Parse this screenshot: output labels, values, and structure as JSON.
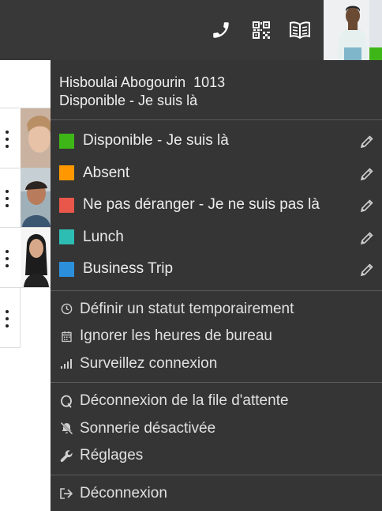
{
  "topbar": {
    "icons": [
      "phone-icon",
      "qr-code-icon",
      "book-icon"
    ],
    "presence_color": "#3fb618"
  },
  "user": {
    "name": "Hisboulai Abogourin",
    "extension": "1013",
    "status": "Disponible - Je suis là"
  },
  "statuses": [
    {
      "label": "Disponible - Je suis là",
      "color": "#3fb618"
    },
    {
      "label": "Absent",
      "color": "#ff9800"
    },
    {
      "label": "Ne pas déranger - Je ne suis pas là",
      "color": "#e8574a"
    },
    {
      "label": "Lunch",
      "color": "#2dbdb3"
    },
    {
      "label": "Business Trip",
      "color": "#2b8fdc"
    }
  ],
  "options_group1": [
    {
      "label": "Définir un statut temporairement",
      "icon": "clock-icon"
    },
    {
      "label": "Ignorer les heures de bureau",
      "icon": "calendar-icon"
    },
    {
      "label": "Surveillez connexion",
      "icon": "signal-bars-icon"
    }
  ],
  "options_group2": [
    {
      "label": "Déconnexion de la file d'attente",
      "icon": "queue-q-icon"
    },
    {
      "label": "Sonnerie désactivée",
      "icon": "bell-slash-icon"
    },
    {
      "label": "Réglages",
      "icon": "wrench-icon"
    }
  ],
  "logout": {
    "label": "Déconnexion",
    "icon": "sign-out-icon"
  }
}
